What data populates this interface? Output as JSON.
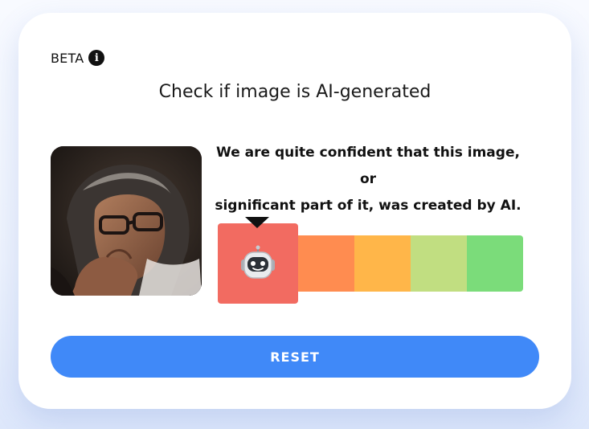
{
  "badge": {
    "label": "BETA",
    "info_icon": "info-icon"
  },
  "title": "Check if image is AI-generated",
  "result": {
    "line1": "We are quite confident that this image, or",
    "line2": "significant part of it, was created by AI."
  },
  "meter": {
    "selected_index": 0,
    "selected_icon": "robot-icon",
    "segment_colors": [
      "#f26b61",
      "#ff8c50",
      "#ffb649",
      "#c1de81",
      "#7bdc7a"
    ]
  },
  "reset_button": {
    "label": "RESET",
    "color": "#4089f8"
  }
}
